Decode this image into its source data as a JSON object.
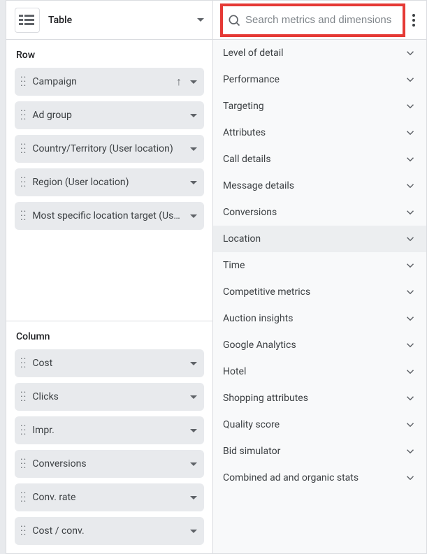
{
  "header": {
    "type_label": "Table"
  },
  "row_section": {
    "title": "Row",
    "chips": [
      {
        "label": "Campaign",
        "sort": "asc"
      },
      {
        "label": "Ad group"
      },
      {
        "label": "Country/Territory (User location)"
      },
      {
        "label": "Region (User location)"
      },
      {
        "label": "Most specific location target (User l..."
      }
    ]
  },
  "column_section": {
    "title": "Column",
    "chips": [
      {
        "label": "Cost"
      },
      {
        "label": "Clicks"
      },
      {
        "label": "Impr."
      },
      {
        "label": "Conversions"
      },
      {
        "label": "Conv. rate"
      },
      {
        "label": "Cost / conv."
      }
    ]
  },
  "search": {
    "placeholder": "Search metrics and dimensions"
  },
  "categories": [
    {
      "label": "Level of detail"
    },
    {
      "label": "Performance"
    },
    {
      "label": "Targeting"
    },
    {
      "label": "Attributes"
    },
    {
      "label": "Call details"
    },
    {
      "label": "Message details"
    },
    {
      "label": "Conversions"
    },
    {
      "label": "Location",
      "highlighted": true
    },
    {
      "label": "Time"
    },
    {
      "label": "Competitive metrics"
    },
    {
      "label": "Auction insights"
    },
    {
      "label": "Google Analytics"
    },
    {
      "label": "Hotel"
    },
    {
      "label": "Shopping attributes"
    },
    {
      "label": "Quality score"
    },
    {
      "label": "Bid simulator"
    },
    {
      "label": "Combined ad and organic stats"
    }
  ]
}
